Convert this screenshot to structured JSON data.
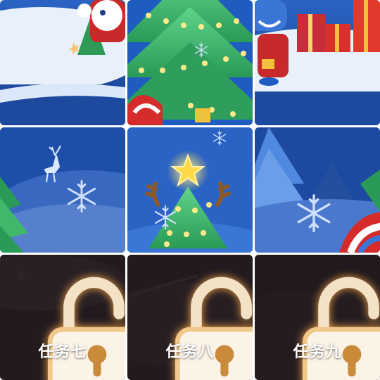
{
  "tiles": [
    {
      "id": 1,
      "state": "unlocked",
      "scene": "snow-hill-with-mascot"
    },
    {
      "id": 2,
      "state": "unlocked",
      "scene": "christmas-tree-lights"
    },
    {
      "id": 3,
      "state": "unlocked",
      "scene": "mascot-with-gifts"
    },
    {
      "id": 4,
      "state": "unlocked",
      "scene": "reindeer-hill"
    },
    {
      "id": 5,
      "state": "unlocked",
      "scene": "tree-with-star-and-antlers"
    },
    {
      "id": 6,
      "state": "unlocked",
      "scene": "forest-snowflake"
    },
    {
      "id": 7,
      "state": "locked",
      "label": "任务七",
      "icon": "open-padlock-icon"
    },
    {
      "id": 8,
      "state": "locked",
      "label": "任务八",
      "icon": "open-padlock-icon"
    },
    {
      "id": 9,
      "state": "locked",
      "label": "任务九",
      "icon": "open-padlock-icon"
    }
  ],
  "colors": {
    "sky_blue": "#1e4fa8",
    "snow": "#e8f0fb",
    "tree_green": "#3fbf6a",
    "light_glow": "#ffe98a",
    "locked_bg": "#2a1f22",
    "lock_glow": "#f7d7a8"
  }
}
